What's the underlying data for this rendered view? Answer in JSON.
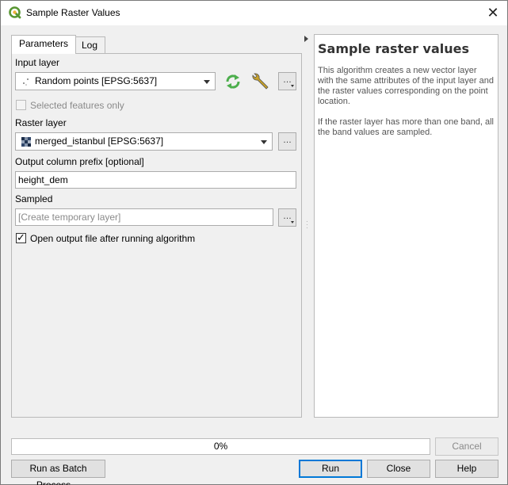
{
  "window": {
    "title": "Sample Raster Values",
    "close": "✕"
  },
  "tabs": [
    {
      "label": "Parameters"
    },
    {
      "label": "Log"
    }
  ],
  "params": {
    "input_layer_label": "Input layer",
    "input_layer_value": "Random points [EPSG:5637]",
    "selected_only_label": "Selected features only",
    "raster_layer_label": "Raster layer",
    "raster_layer_value": "merged_istanbul [EPSG:5637]",
    "prefix_label": "Output column prefix [optional]",
    "prefix_value": "height_dem",
    "sampled_label": "Sampled",
    "sampled_placeholder": "[Create temporary layer]",
    "open_output_label": "Open output file after running algorithm",
    "ellipsis": "…"
  },
  "help": {
    "title": "Sample raster values",
    "para1": "This algorithm creates a new vector layer with the same attributes of the input layer and the raster values corresponding on the point location.",
    "para2": "If the raster layer has more than one band, all the band values are sampled."
  },
  "progress": {
    "text": "0%",
    "value": 0
  },
  "buttons": {
    "cancel": "Cancel",
    "batch": "Run as Batch Process…",
    "run": "Run",
    "close": "Close",
    "help": "Help"
  },
  "icons": {
    "app": "qgis-logo-icon",
    "iterate": "iterate-icon",
    "wrench": "wrench-icon",
    "point_layer": "point-layer-icon",
    "raster_layer": "raster-layer-icon"
  },
  "colors": {
    "qgis_green": "#589632",
    "iterate_green": "#4cae4c",
    "wrench": "#c9a227",
    "default_border": "#0078d7"
  }
}
